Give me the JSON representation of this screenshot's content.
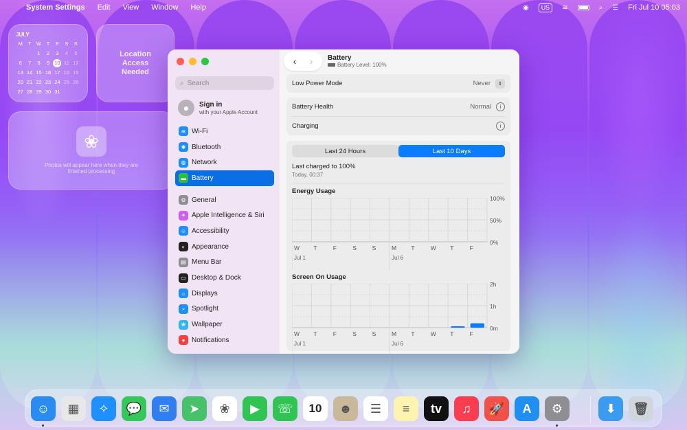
{
  "menubar": {
    "app_name": "System Settings",
    "menus": [
      "Edit",
      "View",
      "Window",
      "Help"
    ],
    "input_source": "US",
    "datetime": "Fri Jul 10  05:03"
  },
  "widgets": {
    "calendar": {
      "month": "JULY",
      "weekdays": [
        "M",
        "T",
        "W",
        "T",
        "F",
        "S",
        "S"
      ],
      "weeks": [
        [
          "",
          "",
          "1",
          "2",
          "3",
          "4",
          "5"
        ],
        [
          "6",
          "7",
          "8",
          "9",
          "10",
          "11",
          "12"
        ],
        [
          "13",
          "14",
          "15",
          "16",
          "17",
          "18",
          "19"
        ],
        [
          "20",
          "21",
          "22",
          "23",
          "24",
          "25",
          "26"
        ],
        [
          "27",
          "28",
          "29",
          "30",
          "31",
          "",
          ""
        ]
      ],
      "today": "10"
    },
    "location_text": "Location\nAccess\nNeeded",
    "photos_text": "Photos will appear here when they are finished processing"
  },
  "sidebar": {
    "search_placeholder": "Search",
    "signin_title": "Sign in",
    "signin_sub": "with your Apple Account",
    "items": [
      {
        "label": "Wi-Fi",
        "icon": "wifi-icon",
        "color": "#1f8ef5",
        "glyph": "≋"
      },
      {
        "label": "Bluetooth",
        "icon": "bluetooth-icon",
        "color": "#1f8ef5",
        "glyph": "✱"
      },
      {
        "label": "Network",
        "icon": "network-icon",
        "color": "#1f8ef5",
        "glyph": "◍"
      },
      {
        "label": "Battery",
        "icon": "battery-icon",
        "color": "#2bc13f",
        "glyph": "▬",
        "active": true
      }
    ],
    "items2": [
      {
        "label": "General",
        "icon": "gear-icon",
        "color": "#8e8e93",
        "glyph": "⚙"
      },
      {
        "label": "Apple Intelligence & Siri",
        "icon": "siri-icon",
        "color": "#d35cf0",
        "glyph": "✦"
      },
      {
        "label": "Accessibility",
        "icon": "accessibility-icon",
        "color": "#1f8ef5",
        "glyph": "☺"
      },
      {
        "label": "Appearance",
        "icon": "appearance-icon",
        "color": "#222222",
        "glyph": "◐"
      },
      {
        "label": "Menu Bar",
        "icon": "menubar-icon",
        "color": "#8e8e93",
        "glyph": "▤"
      },
      {
        "label": "Desktop & Dock",
        "icon": "desktop-dock-icon",
        "color": "#222222",
        "glyph": "▭"
      },
      {
        "label": "Displays",
        "icon": "displays-icon",
        "color": "#1f8ef5",
        "glyph": "☼"
      },
      {
        "label": "Spotlight",
        "icon": "spotlight-icon",
        "color": "#1f8ef5",
        "glyph": "⌕"
      },
      {
        "label": "Wallpaper",
        "icon": "wallpaper-icon",
        "color": "#31b7f0",
        "glyph": "❀"
      },
      {
        "label": "Notifications",
        "icon": "notifications-icon",
        "color": "#f04040",
        "glyph": "●"
      }
    ]
  },
  "header": {
    "title": "Battery",
    "subtitle": "Battery Level: 100%"
  },
  "settings": {
    "low_power_label": "Low Power Mode",
    "low_power_value": "Never",
    "health_label": "Battery Health",
    "health_value": "Normal",
    "charging_label": "Charging"
  },
  "usage": {
    "tabs": [
      "Last 24 Hours",
      "Last 10 Days"
    ],
    "selected_tab": "Last 10 Days",
    "last_charged": "Last charged to 100%",
    "last_charged_time": "Today, 00:37"
  },
  "chart_data": [
    {
      "type": "bar",
      "title": "Energy Usage",
      "categories": [
        "W",
        "T",
        "F",
        "S",
        "S",
        "M",
        "T",
        "W",
        "T",
        "F"
      ],
      "date_labels": [
        "Jul 1",
        "Jul 6"
      ],
      "values": [
        0,
        0,
        0,
        0,
        0,
        0,
        0,
        0,
        0,
        0
      ],
      "y_ticks": [
        "100%",
        "50%",
        "0%"
      ],
      "ylim": [
        0,
        100
      ],
      "grid": true
    },
    {
      "type": "bar",
      "title": "Screen On Usage",
      "categories": [
        "W",
        "T",
        "F",
        "S",
        "S",
        "M",
        "T",
        "W",
        "T",
        "F"
      ],
      "date_labels": [
        "Jul 1",
        "Jul 6"
      ],
      "values": [
        0,
        0,
        0,
        0,
        0,
        0,
        0,
        0,
        0.05,
        0.2
      ],
      "y_ticks": [
        "2h",
        "1h",
        "0m"
      ],
      "ylim": [
        0,
        2
      ],
      "grid": true,
      "bar_color": "#0a7cff"
    }
  ],
  "dock": [
    {
      "name": "finder-icon",
      "color": "#2a8cf0",
      "glyph": "☺",
      "running": true
    },
    {
      "name": "launchpad-icon",
      "color": "#e8e8e8",
      "glyph": "▦"
    },
    {
      "name": "safari-icon",
      "color": "#1e90ff",
      "glyph": "✧"
    },
    {
      "name": "messages-icon",
      "color": "#34c759",
      "glyph": "💬"
    },
    {
      "name": "mail-icon",
      "color": "#2f7ff0",
      "glyph": "✉"
    },
    {
      "name": "maps-icon",
      "color": "#48c26a",
      "glyph": "➤"
    },
    {
      "name": "photos-icon",
      "color": "#ffffff",
      "glyph": "❀"
    },
    {
      "name": "facetime-icon",
      "color": "#30c453",
      "glyph": "▶"
    },
    {
      "name": "phone-icon",
      "color": "#30c453",
      "glyph": "☏"
    },
    {
      "name": "calendar-icon",
      "color": "#ffffff",
      "glyph": "10"
    },
    {
      "name": "contacts-icon",
      "color": "#c9b89a",
      "glyph": "☻"
    },
    {
      "name": "reminders-icon",
      "color": "#ffffff",
      "glyph": "☰"
    },
    {
      "name": "notes-icon",
      "color": "#fff3b0",
      "glyph": "≡"
    },
    {
      "name": "appletv-icon",
      "color": "#111111",
      "glyph": "tv"
    },
    {
      "name": "music-icon",
      "color": "#fb3d52",
      "glyph": "♫"
    },
    {
      "name": "rocket-icon",
      "color": "#f0524a",
      "glyph": "🚀"
    },
    {
      "name": "appstore-icon",
      "color": "#1f8ef5",
      "glyph": "A"
    },
    {
      "name": "system-settings-icon",
      "color": "#8e8e93",
      "glyph": "⚙",
      "running": true
    },
    {
      "name": "downloads-folder-icon",
      "color": "#3a9bf0",
      "glyph": "⬇"
    },
    {
      "name": "trash-icon",
      "color": "#d0d6dc",
      "glyph": "🗑"
    }
  ]
}
